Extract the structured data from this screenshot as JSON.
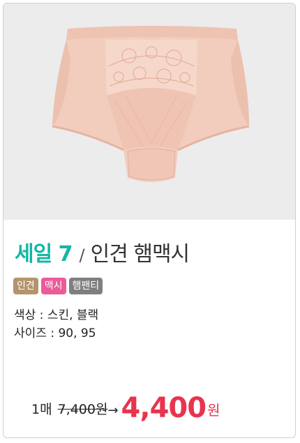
{
  "product": {
    "image_alt": "",
    "sale_label": "세일 7",
    "slash": "/",
    "name": "인견 햄맥시",
    "tags": [
      {
        "label": "인견",
        "color": "#b3946d"
      },
      {
        "label": "맥시",
        "color": "#ec5a99"
      },
      {
        "label": "햄팬티",
        "color": "#7f7f7f"
      }
    ],
    "color_spec": "색상 : 스킨, 블랙",
    "size_spec": "사이즈 : 90, 95"
  },
  "price": {
    "quantity": "1매",
    "original": "7,400원",
    "arrow": "→",
    "sale": "4,400",
    "currency": "원"
  },
  "colors": {
    "accent_teal": "#14b6a4",
    "price_red": "#e8344f",
    "garment": "#f2cdbd"
  }
}
